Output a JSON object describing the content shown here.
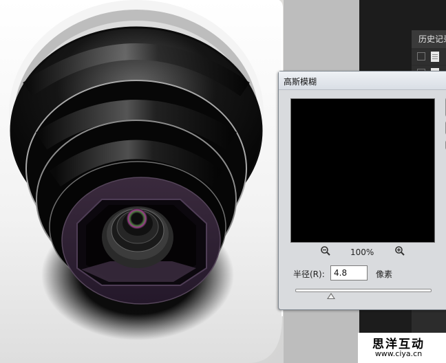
{
  "history_panel": {
    "title": "历史记录",
    "rows": [
      {
        "checked": false
      },
      {
        "checked": false
      }
    ]
  },
  "dialog": {
    "title": "高斯模糊",
    "zoom_out_icon": "zoom-out-icon",
    "zoom_in_icon": "zoom-in-icon",
    "zoom_level": "100%",
    "radius_label": "半径(R):",
    "radius_value": "4.8",
    "radius_unit": "像素",
    "slider": {
      "min": 0.1,
      "max": 1000,
      "value": 4.8,
      "thumb_fraction": 0.26
    }
  },
  "watermark": {
    "main": "思洋互动",
    "url": "www.ciya.cn"
  },
  "colors": {
    "preview_bg": "#000000",
    "dialog_bg": "#d9dbde",
    "lens_purple": "#3b2a3f"
  }
}
